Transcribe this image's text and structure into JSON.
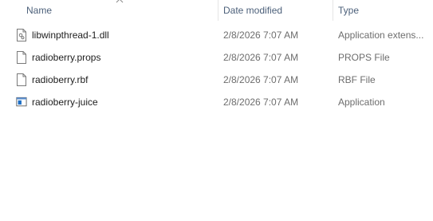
{
  "columns": {
    "name": "Name",
    "date_modified": "Date modified",
    "type": "Type"
  },
  "files": [
    {
      "name": "libwinpthread-1.dll",
      "date": "2/8/2026 7:07 AM",
      "type": "Application extens...",
      "icon": "dll-file-icon"
    },
    {
      "name": "radioberry.props",
      "date": "2/8/2026 7:07 AM",
      "type": "PROPS File",
      "icon": "generic-file-icon"
    },
    {
      "name": "radioberry.rbf",
      "date": "2/8/2026 7:07 AM",
      "type": "RBF File",
      "icon": "generic-file-icon"
    },
    {
      "name": "radioberry-juice",
      "date": "2/8/2026 7:07 AM",
      "type": "Application",
      "icon": "application-icon"
    }
  ],
  "colors": {
    "header_text": "#4c607a",
    "secondary_text": "#6d6d6d",
    "app_icon_blue": "#1f6fc5"
  }
}
